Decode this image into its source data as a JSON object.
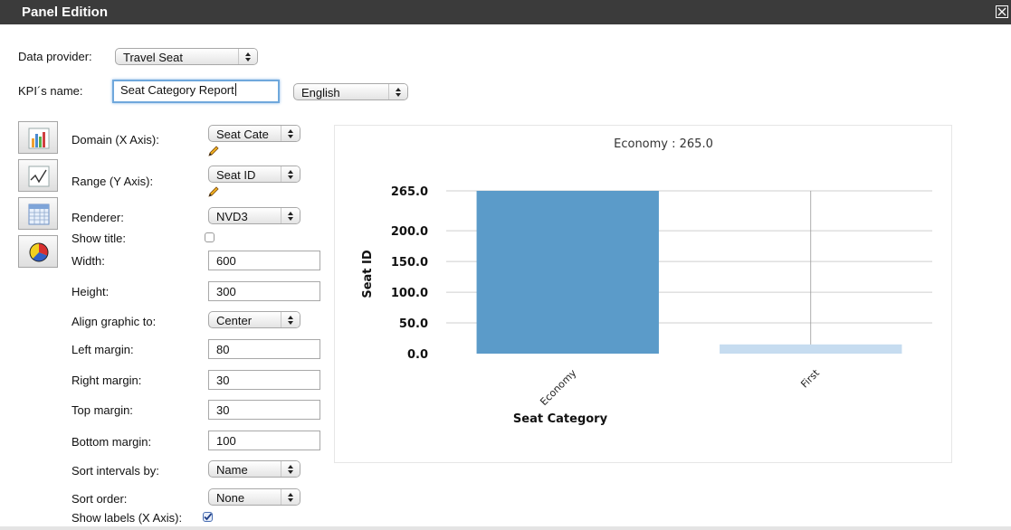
{
  "window": {
    "title": "Panel Edition"
  },
  "data_provider": {
    "label": "Data provider:",
    "value": "Travel Seat"
  },
  "kpi": {
    "label": "KPI´s name:",
    "value": "Seat Category Report",
    "language": "English"
  },
  "form": {
    "domain": {
      "label": "Domain (X Axis):",
      "value": "Seat Cate "
    },
    "range": {
      "label": "Range (Y Axis):",
      "value": "Seat ID"
    },
    "renderer": {
      "label": "Renderer:",
      "value": "NVD3"
    },
    "show_title": {
      "label": "Show title:",
      "checked": false
    },
    "width": {
      "label": "Width:",
      "value": "600"
    },
    "height": {
      "label": "Height:",
      "value": "300"
    },
    "align": {
      "label": "Align graphic to:",
      "value": "Center"
    },
    "left_margin": {
      "label": "Left margin:",
      "value": "80"
    },
    "right_margin": {
      "label": "Right margin:",
      "value": "30"
    },
    "top_margin": {
      "label": "Top margin:",
      "value": "30"
    },
    "bottom_margin": {
      "label": "Bottom margin:",
      "value": "100"
    },
    "sort_by": {
      "label": "Sort intervals by:",
      "value": "Name"
    },
    "sort_order": {
      "label": "Sort order:",
      "value": "None"
    },
    "show_labels": {
      "label": "Show labels (X Axis):",
      "checked": true
    }
  },
  "chart_types": [
    "bar-chart-icon",
    "line-chart-icon",
    "table-icon",
    "pie-chart-icon"
  ],
  "chart_data": {
    "type": "bar",
    "tooltip": "Economy : 265.0",
    "categories": [
      "Economy",
      "First"
    ],
    "values": [
      265,
      15
    ],
    "ylabel": "Seat ID",
    "xlabel": "Seat Category",
    "yticks": [
      "265.0",
      "200.0",
      "150.0",
      "100.0",
      "50.0",
      "0.0"
    ],
    "ytick_values": [
      265,
      200,
      150,
      100,
      50,
      0
    ],
    "ylim": [
      0,
      265
    ],
    "grid": true,
    "colors": [
      "#5b9bc9",
      "#c6dcf0"
    ]
  }
}
